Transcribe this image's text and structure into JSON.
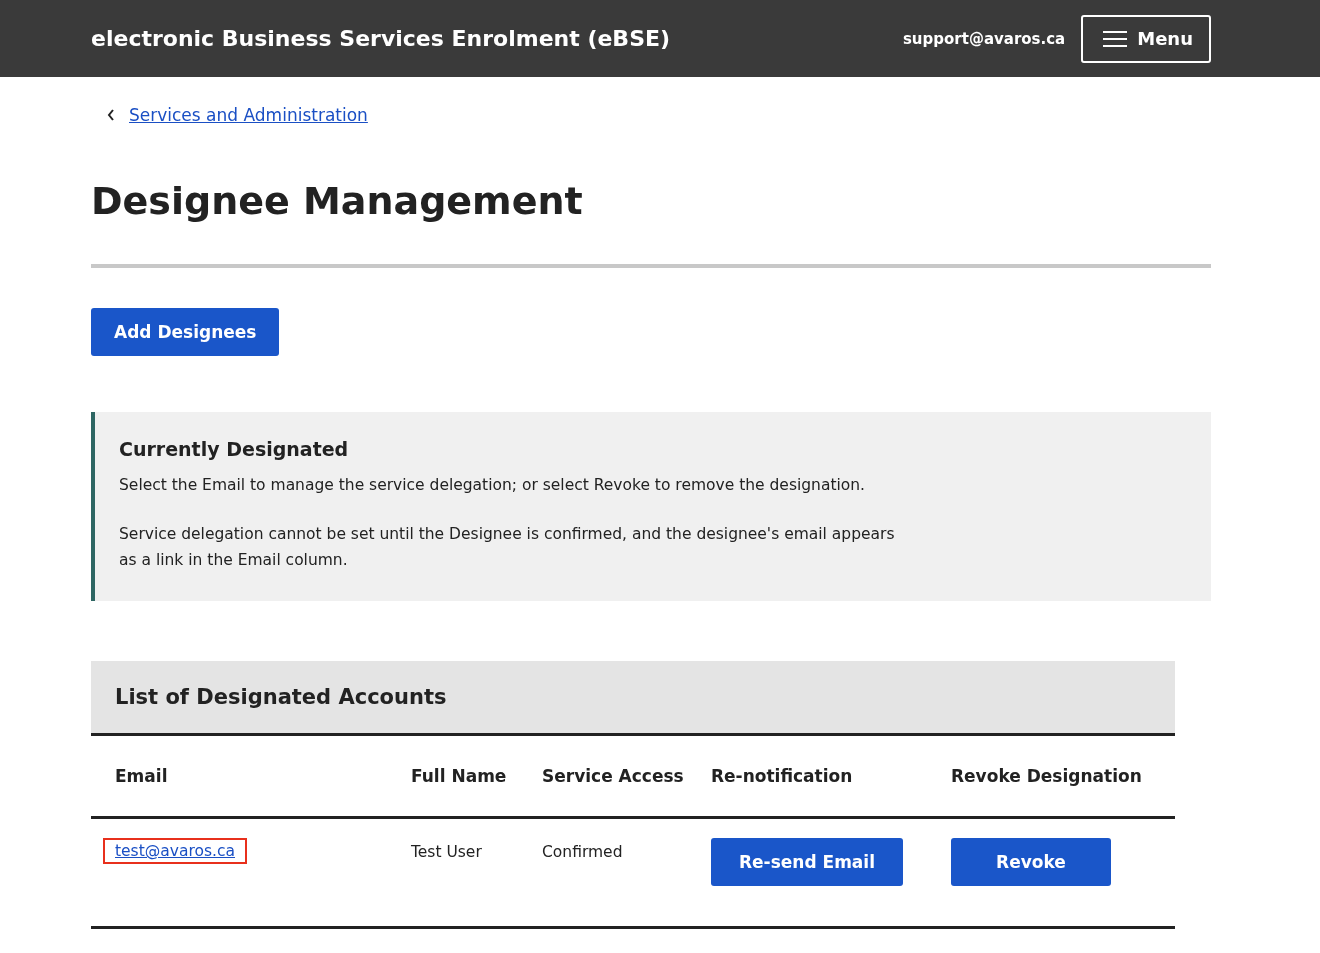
{
  "header": {
    "title": "electronic Business Services Enrolment (eBSE)",
    "email": "support@avaros.ca",
    "menu_label": "Menu"
  },
  "breadcrumb": {
    "label": "Services and Administration"
  },
  "page_title": "Designee Management",
  "add_button": "Add Designees",
  "notice": {
    "title": "Currently Designated",
    "paragraphs": [
      "Select the Email to manage the service delegation; or select Revoke to remove the designation.",
      "Service delegation cannot be set until the Designee is confirmed, and the designee's email appears as a link in the Email column."
    ]
  },
  "table": {
    "caption": "List of Designated Accounts",
    "columns": [
      "Email",
      "Full Name",
      "Service Access",
      "Re-notification",
      "Revoke Designation"
    ],
    "rows": [
      {
        "email": "test@avaros.ca",
        "highlighted": true,
        "full_name": "Test User",
        "service_access": "Confirmed",
        "renotify_button": "Re-send Email",
        "revoke_button": "Revoke"
      }
    ]
  }
}
